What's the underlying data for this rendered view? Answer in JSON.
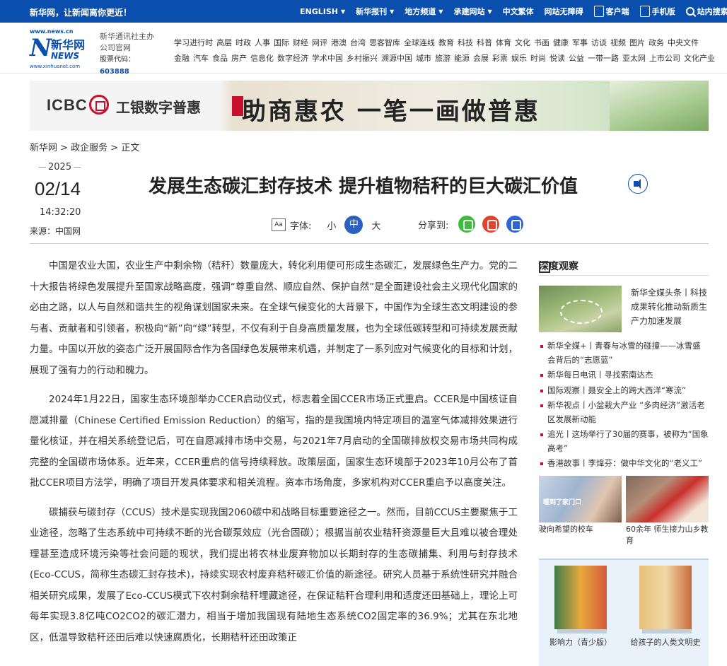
{
  "topbar": {
    "slogan": "新华网，让新闻离你更近！",
    "nav": [
      {
        "label": "ENGLISH",
        "dropdown": true
      },
      {
        "label": "新华报刊",
        "dropdown": true
      },
      {
        "label": "地方频道",
        "dropdown": true
      },
      {
        "label": "承建网站",
        "dropdown": true
      },
      {
        "label": "中文繁体",
        "dropdown": false
      },
      {
        "label": "网站无障碍",
        "dropdown": false
      },
      {
        "label": "客户端",
        "icon": "phone-icon"
      },
      {
        "label": "手机版",
        "icon": "mobile-icon"
      },
      {
        "label": "站内搜索",
        "icon": "search-icon"
      }
    ]
  },
  "header": {
    "logo": {
      "url_top": "www.news.cn",
      "cn": "新华网",
      "en": "NEWS",
      "url_bottom": "www.xinhuanet.com"
    },
    "company": {
      "line1": "新华通讯社主办",
      "line2": "公司官网",
      "code_label": "股票代码：",
      "code": "603888"
    },
    "channels_row1": [
      "学习进行时",
      "高层",
      "时政",
      "人事",
      "国际",
      "财经",
      "网评",
      "港澳",
      "台湾",
      "思客智库",
      "全球连线",
      "教育",
      "科技",
      "科普",
      "体育",
      "文化",
      "书画",
      "健康",
      "军事",
      "访谈",
      "视频",
      "图片",
      "政务",
      "中央文件"
    ],
    "channels_row2": [
      "金融",
      "汽车",
      "食品",
      "房产",
      "信息化",
      "数字经济",
      "学术中国",
      "乡村振兴",
      "溯源中国",
      "城市",
      "旅游",
      "能源",
      "会展",
      "彩票",
      "娱乐",
      "时尚",
      "悦读",
      "公益",
      "一带一路",
      "亚太网",
      "上市公司",
      "文化产业"
    ]
  },
  "banner": {
    "brand": "ICBC",
    "brand_cn": "工银数字普惠",
    "slogan": "助商惠农 一笔一画做普惠"
  },
  "breadcrumb": "新华网 > 政企服务 > 正文",
  "article_meta": {
    "year": "2025",
    "day": "02/14",
    "time": "14:32:20",
    "source": "来源：中国网"
  },
  "title": "发展生态碳汇封存技术 提升植物秸秆的巨大碳汇价值",
  "fontbar": {
    "label": "字体:",
    "small": "小",
    "medium": "中",
    "large": "大"
  },
  "share": {
    "label": "分享到:"
  },
  "paragraphs": [
    "中国是农业大国，农业生产中剩余物（秸秆）数量庞大，转化利用便可形成生态碳汇，发展绿色生产力。党的二十大报告将绿色发展提升至国家战略高度，强调“尊重自然、顺应自然、保护自然”是全面建设社会主义现代化国家的必由之路，以人与自然和谐共生的视角谋划国家未来。在全球气候变化的大背景下，中国作为全球生态文明建设的参与者、贡献者和引领者，积极向“新”向“绿”转型，不仅有利于自身高质量发展，也为全球低碳转型和可持续发展贡献力量。中国以开放的姿态广泛开展国际合作为各国绿色发展带来机遇，并制定了一系列应对气候变化的目标和计划，展现了强有力的行动和魄力。",
    "2024年1月22日，国家生态环境部举办CCER启动仪式，标志着全国CCER市场正式重启。CCER是中国核证自愿减排量（Chinese Certified Emission Reduction）的缩写，指的是我国境内特定项目的温室气体减排效果进行量化核证，并在相关系统登记后，可在自愿减排市场中交易，与2021年7月启动的全国碳排放权交易市场共同构成完整的全国碳市场体系。近年来，CCER重启的信号持续释放。政策层面，国家生态环境部于2023年10月公布了首批CCER项目方法学，明确了项目开发具体要求和相关流程。资本市场角度，多家机构对CCER重启予以高度关注。",
    "碳捕获与碳封存（CCUS）技术是实现我国2060碳中和战略目标重要途径之一。然而，目前CCUS主要聚焦于工业途径，忽略了生态系统中可持续不断的光合碳泵效应（光合固碳）；根据当前农业秸秆资源量巨大且难以被合理处理甚至造成环境污染等社会问题的现状，我们提出将农林业废弃物加以长期封存的生态碳捕集、利用与封存技术 (Eco-CCUS，简称生态碳汇封存技术)，持续实现农村废弃秸秆碳汇价值的新途径。研究人员基于系统性研究并融合相关研究成果，发展了Eco-CCUS模式下农村剩余秸秆埋藏途径，在保证秸秆合理利用和适度还田基础上，理论上可每年实现3.8亿吨CO2CO2的碳汇潜力，相当于增加我国现有陆地生态系统CO2固定率的36.9%；尤其在东北地区，低温导致秸秆还田后难以快速腐质化，长期秸秆还田政策正"
  ],
  "sidebar": {
    "heading": "深度观察",
    "top_story": "新华全媒头条丨科技成果转化推动新质生产力加速发展",
    "list": [
      "新华全媒+丨青春与冰雪的碰撞——冰雪盛会背后的“志愿蓝”",
      "新华每日电讯丨寻找索南达杰",
      "国际观察丨聂安全上的跨大西洋“寒流”",
      "新华视点丨小盆栽大产业 “多肉经济”激活老区发展新动能",
      "追光丨这场举行了30届的赛事，被称为“国象高考”",
      "香港故事丨李煒芬：做中华文化的“老义工”"
    ],
    "pics": [
      {
        "caption": "驶向希望的校车"
      },
      {
        "caption": "60余年 师生接力山乡教育"
      }
    ],
    "books": [
      {
        "caption": "影响力（青少版）"
      },
      {
        "caption": "给孩子的人类文明史"
      }
    ]
  }
}
